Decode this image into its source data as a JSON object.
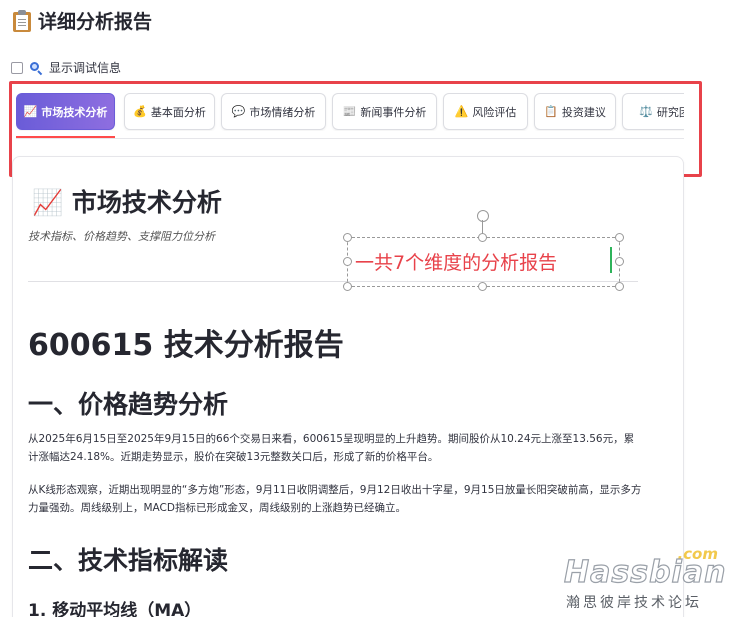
{
  "header": {
    "title": "详细分析报告",
    "icon": "clipboard-icon"
  },
  "debug": {
    "label": "显示调试信息",
    "checked": false,
    "icon": "magnifier-icon"
  },
  "tabs": [
    {
      "label": "市场技术分析",
      "icon": "📈",
      "active": true
    },
    {
      "label": "基本面分析",
      "icon": "💰",
      "active": false
    },
    {
      "label": "市场情绪分析",
      "icon": "💬",
      "active": false
    },
    {
      "label": "新闻事件分析",
      "icon": "📰",
      "active": false
    },
    {
      "label": "风险评估",
      "icon": "⚠️",
      "active": false
    },
    {
      "label": "投资建议",
      "icon": "📋",
      "active": false
    },
    {
      "label": "研究团",
      "icon": "⚖️",
      "active": false
    }
  ],
  "section": {
    "title": "📈 市场技术分析",
    "subtitle": "技术指标、价格趋势、支撑阻力位分析"
  },
  "annotation": {
    "text": "一共7个维度的分析报告"
  },
  "report": {
    "title": "600615 技术分析报告",
    "h2_price": "一、价格趋势分析",
    "para1": "从2025年6月15日至2025年9月15日的66个交易日来看，600615呈现明显的上升趋势。期间股价从10.24元上涨至13.56元，累计涨幅达24.18%。近期走势显示，股价在突破13元整数关口后，形成了新的价格平台。",
    "para2": "从K线形态观察，近期出现明显的“多方炮”形态，9月11日收阴调整后，9月12日收出十字星，9月15日放量长阳突破前高，显示多方力量强劲。周线级别上，MACD指标已形成金叉，周线级别的上涨趋势已经确立。",
    "h2_tech": "二、技术指标解读",
    "h3_ma": "1. 移动平均线（MA）"
  },
  "watermark": {
    "com": ".com",
    "main": "Hassbian",
    "sub": "瀚思彼岸技术论坛"
  },
  "colors": {
    "accent": "#6a5cd8",
    "highlight": "#e8424a",
    "underline": "#ff4b4b"
  }
}
